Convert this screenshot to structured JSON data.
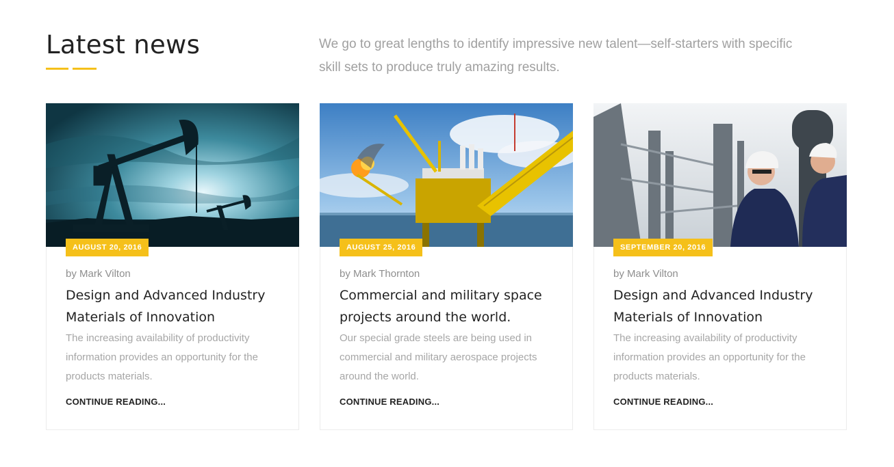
{
  "section": {
    "title": "Latest news",
    "intro": "We go to great lengths to identify impressive new talent—self-starters with specific skill sets to produce truly amazing results."
  },
  "colors": {
    "accent": "#f5c01a",
    "heading": "#222222",
    "muted_text": "#a6a6a6"
  },
  "posts": [
    {
      "image": "oil-pumpjack-sunset-photo",
      "date": "AUGUST 20, 2016",
      "author": "by Mark Vilton",
      "title": "Design and Advanced Industry Materials of Innovation",
      "excerpt": "The increasing availability of productivity information provides an opportunity for the products materials.",
      "link": "CONTINUE READING..."
    },
    {
      "image": "offshore-oil-platform-photo",
      "date": "AUGUST 25, 2016",
      "author": "by Mark Thornton",
      "title": "Commercial and military space projects around the world.",
      "excerpt": "Our special grade steels are being used in commercial and military aerospace projects around the world.",
      "link": "CONTINUE READING..."
    },
    {
      "image": "refinery-engineers-photo",
      "date": "SEPTEMBER 20, 2016",
      "author": "by Mark Vilton",
      "title": "Design and Advanced Industry Materials of Innovation",
      "excerpt": "The increasing availability of productivity information provides an opportunity for the products materials.",
      "link": "CONTINUE READING..."
    }
  ]
}
